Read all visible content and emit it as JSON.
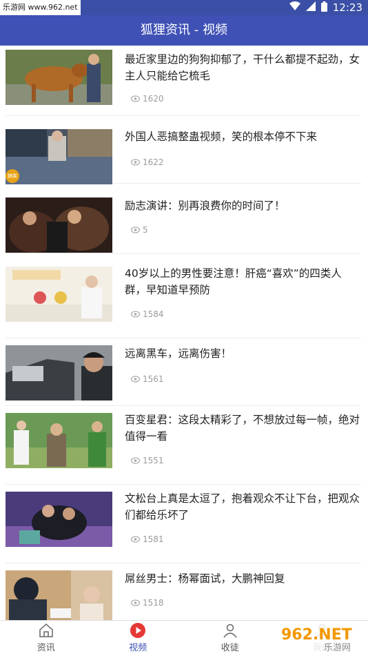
{
  "status": {
    "watermark_top": "乐游网 www.962.net",
    "time": "12:23"
  },
  "app_bar": {
    "title": "狐狸资讯 - 视频"
  },
  "items": [
    {
      "title": "最近家里边的狗狗抑郁了，干什么都提不起劲，女主人只能给它梳毛",
      "views": "1620"
    },
    {
      "title": "外国人恶搞整蛊视频，笑的根本停不下来",
      "views": "1622"
    },
    {
      "title": "励志演讲：别再浪费你的时间了！",
      "views": "5"
    },
    {
      "title": "40岁以上的男性要注意！肝癌“喜欢”的四类人群，早知道早预防",
      "views": "1584"
    },
    {
      "title": "远离黑车，远离伤害！",
      "views": "1561"
    },
    {
      "title": "百变星君：这段太精彩了，不想放过每一帧，绝对值得一看",
      "views": "1551"
    },
    {
      "title": "文松台上真是太逗了，抱着观众不让下台，把观众们都给乐坏了",
      "views": "1581"
    },
    {
      "title": "屌丝男士：杨幂面试，大鹏神回复",
      "views": "1518"
    }
  ],
  "thumb_badge": "搞笑",
  "nav": [
    {
      "label": "资讯",
      "icon": "home-icon"
    },
    {
      "label": "视频",
      "icon": "play-icon"
    },
    {
      "label": "收徒",
      "icon": "people-icon"
    },
    {
      "label": "我的",
      "icon": "user-icon"
    }
  ],
  "watermark": {
    "logo": "962.NET",
    "sub": "乐游网"
  },
  "colors": {
    "primary": "#3f51b5",
    "play_red": "#e53935"
  }
}
